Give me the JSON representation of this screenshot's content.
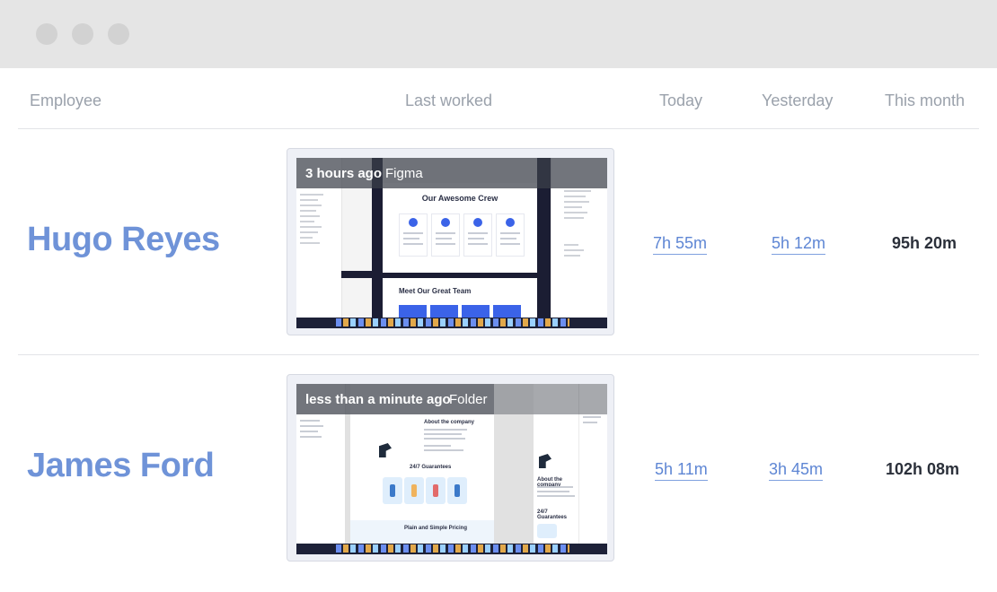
{
  "headers": {
    "employee": "Employee",
    "last_worked": "Last worked",
    "today": "Today",
    "yesterday": "Yesterday",
    "this_month": "This month"
  },
  "rows": [
    {
      "name": "Hugo Reyes",
      "last_worked_time": "3 hours ago",
      "last_worked_app": "Figma",
      "today": "7h 55m",
      "yesterday": "5h 12m",
      "this_month": "95h 20m",
      "thumb": {
        "crew_title": "Our Awesome Crew",
        "team_title": "Meet Our Great Team"
      }
    },
    {
      "name": "James Ford",
      "last_worked_time": "less than a minute ago",
      "last_worked_app": "Folder",
      "today": "5h 11m",
      "yesterday": "3h 45m",
      "this_month": "102h 08m",
      "thumb": {
        "about_title": "About the company",
        "guarantee_title": "24/7 Guarantees",
        "pricing_title": "Plain and Simple Pricing",
        "about_title_2": "About the company",
        "guarantee_title_2": "24/7 Guarantees"
      }
    }
  ],
  "colors": {
    "name": "#6f93d8",
    "link": "#5e86d4",
    "header_text": "#9aa1ab",
    "month_text": "#2b303a",
    "titlebar": "#e5e5e5"
  },
  "icons": [
    "window-close-dot",
    "window-minimize-dot",
    "window-maximize-dot"
  ]
}
